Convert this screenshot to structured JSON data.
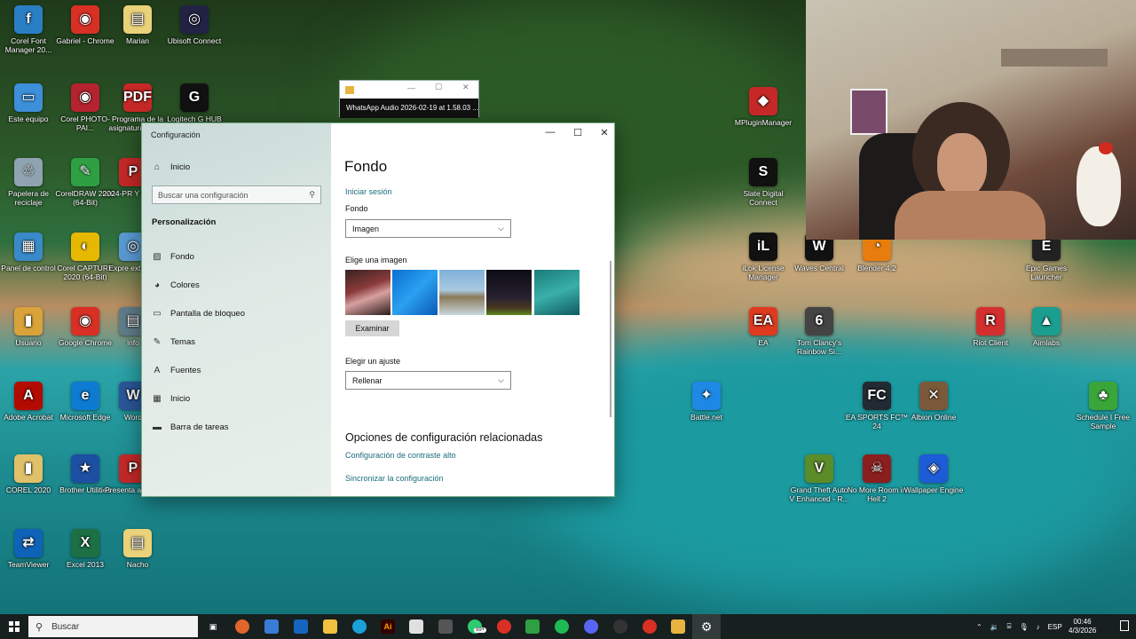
{
  "desktop": {
    "icons": [
      {
        "label": "Corel Font Manager 20...",
        "glyph": "f",
        "color": "#2a7fc4"
      },
      {
        "label": "Gabriel - Chrome",
        "glyph": "◉",
        "color": "#d93025"
      },
      {
        "label": "Marian",
        "glyph": "▤",
        "color": "#e9d27a"
      },
      {
        "label": "Ubisoft Connect",
        "glyph": "◎",
        "color": "#222244"
      },
      {
        "label": "Este equipo",
        "glyph": "▭",
        "color": "#3c8fd8"
      },
      {
        "label": "Corel PHOTO-PAI...",
        "glyph": "◉",
        "color": "#b52330"
      },
      {
        "label": "Programa de la asignatura Mult...",
        "glyph": "PDF",
        "color": "#c62828"
      },
      {
        "label": "Logitech G HUB",
        "glyph": "G",
        "color": "#111111"
      },
      {
        "label": "Papelera de reciclaje",
        "glyph": "♲",
        "color": "#8fa3b0"
      },
      {
        "label": "CorelDRAW 2020 (64-Bit)",
        "glyph": "✎",
        "color": "#2ea043"
      },
      {
        "label": "2024-PR Y CRON",
        "glyph": "P",
        "color": "#c62828"
      },
      {
        "label": "Panel de control",
        "glyph": "▦",
        "color": "#3a89c9"
      },
      {
        "label": "Corel CAPTURE 2020 (64-Bit)",
        "glyph": "◐",
        "color": "#e6b800"
      },
      {
        "label": "Expre extracto",
        "glyph": "◎",
        "color": "#5a9bd5"
      },
      {
        "label": "Usuario",
        "glyph": "▮",
        "color": "#d9a33a"
      },
      {
        "label": "Google Chrome",
        "glyph": "◉",
        "color": "#d93025"
      },
      {
        "label": "info",
        "glyph": "▤",
        "color": "#607d8b"
      },
      {
        "label": "Adobe Acrobat",
        "glyph": "A",
        "color": "#b30b00"
      },
      {
        "label": "Microsoft Edge",
        "glyph": "e",
        "color": "#0c7bd1"
      },
      {
        "label": "Word",
        "glyph": "W",
        "color": "#2b579a"
      },
      {
        "label": "COREL 2020",
        "glyph": "▮",
        "color": "#e0c16a"
      },
      {
        "label": "Brother Utilities",
        "glyph": "★",
        "color": "#1d4fa3"
      },
      {
        "label": "Presenta aliment",
        "glyph": "P",
        "color": "#c62828"
      },
      {
        "label": "TeamViewer",
        "glyph": "⇄",
        "color": "#0e62b8"
      },
      {
        "label": "Excel 2013",
        "glyph": "X",
        "color": "#1d7044"
      },
      {
        "label": "Nacho",
        "glyph": "▤",
        "color": "#e9d27a"
      },
      {
        "label": "MPluginManager",
        "glyph": "◆",
        "color": "#c62828"
      },
      {
        "label": "Slate Digital Connect",
        "glyph": "S",
        "color": "#111111"
      },
      {
        "label": "iLok License Manager",
        "glyph": "iL",
        "color": "#111111"
      },
      {
        "label": "Waves Central",
        "glyph": "W",
        "color": "#111111"
      },
      {
        "label": "Blender 4.2",
        "glyph": "◔",
        "color": "#e87d0d"
      },
      {
        "label": "Epic Games Launcher",
        "glyph": "E",
        "color": "#222222"
      },
      {
        "label": "EA",
        "glyph": "EA",
        "color": "#e03a1e"
      },
      {
        "label": "Tom Clancy's Rainbow Si...",
        "glyph": "6",
        "color": "#444444"
      },
      {
        "label": "Riot Client",
        "glyph": "R",
        "color": "#d32f2f"
      },
      {
        "label": "Aimlabs",
        "glyph": "▲",
        "color": "#1b9e8f"
      },
      {
        "label": "Battle.net",
        "glyph": "✦",
        "color": "#1e88e5"
      },
      {
        "label": "EA SPORTS FC™ 24",
        "glyph": "FC",
        "color": "#222a33"
      },
      {
        "label": "Albion Online",
        "glyph": "✕",
        "color": "#7a5a3a"
      },
      {
        "label": "Schedule I Free Sample",
        "glyph": "♣",
        "color": "#3aa63a"
      },
      {
        "label": "Grand Theft Auto V Enhanced - R...",
        "glyph": "V",
        "color": "#5b8c2a"
      },
      {
        "label": "No More Room in Hell 2",
        "glyph": "☠",
        "color": "#8b1e1e"
      },
      {
        "label": "Wallpaper Engine",
        "glyph": "◈",
        "color": "#1e5bd6"
      }
    ]
  },
  "media_window": {
    "title": "WhatsApp Audio 2026-02-19 at 1.58.03 ..."
  },
  "settings": {
    "window_title": "Configuración",
    "home": "Inicio",
    "search_placeholder": "Buscar una configuración",
    "section": "Personalización",
    "nav": [
      {
        "label": "Fondo",
        "icon": "picture-icon"
      },
      {
        "label": "Colores",
        "icon": "palette-icon"
      },
      {
        "label": "Pantalla de bloqueo",
        "icon": "lock-screen-icon"
      },
      {
        "label": "Temas",
        "icon": "brush-icon"
      },
      {
        "label": "Fuentes",
        "icon": "font-icon"
      },
      {
        "label": "Inicio",
        "icon": "start-icon"
      },
      {
        "label": "Barra de tareas",
        "icon": "taskbar-icon"
      }
    ],
    "page_title": "Fondo",
    "signin_link": "Iniciar sesión",
    "background_label": "Fondo",
    "background_value": "Imagen",
    "choose_image_label": "Elige una imagen",
    "browse_button": "Examinar",
    "fit_label": "Elegir un ajuste",
    "fit_value": "Rellenar",
    "related_title": "Opciones de configuración relacionadas",
    "related_links": [
      "Configuración de contraste alto",
      "Sincronizar la configuración"
    ]
  },
  "taskbar": {
    "search_label": "Buscar",
    "badge": "99+",
    "lang": "ESP",
    "time": "00:46",
    "date": "4/3/2026"
  }
}
